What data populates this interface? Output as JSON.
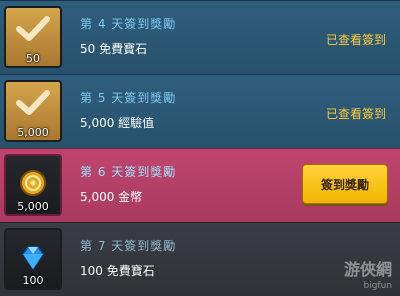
{
  "rewards": [
    {
      "day_title": "第 4 天簽到獎勵",
      "reward_text": "50 免費寶石",
      "icon_qty": "50",
      "icon": "check-icon",
      "status_text": "已查看簽到"
    },
    {
      "day_title": "第 5 天簽到獎勵",
      "reward_text": "5,000 經驗值",
      "icon_qty": "5,000",
      "icon": "check-icon",
      "status_text": "已查看簽到"
    },
    {
      "day_title": "第 6 天簽到獎勵",
      "reward_text": "5,000 金幣",
      "icon_qty": "5,000",
      "icon": "gold-coin-icon",
      "button_label": "簽到獎勵"
    },
    {
      "day_title": "第 7 天簽到獎勵",
      "reward_text": "100 免費寶石",
      "icon_qty": "100",
      "icon": "diamond-gem-icon"
    }
  ],
  "watermark": {
    "text": "游俠網",
    "sub": "bigfun"
  },
  "colors": {
    "claimed_row": "#2f5e7d",
    "active_row": "#c0456f",
    "locked_row": "#3a3d43",
    "status_yellow": "#ffcc3a",
    "button_yellow": "#ffd23a"
  }
}
